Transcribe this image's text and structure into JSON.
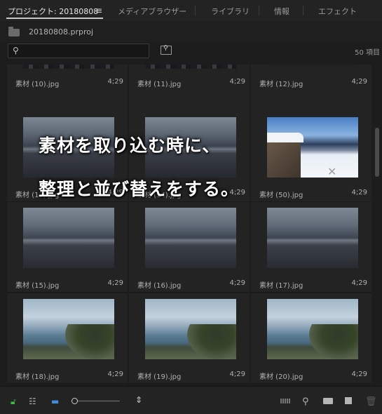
{
  "tabs": [
    {
      "label": "プロジェクト: 20180808",
      "active": true
    },
    {
      "label": "メディアブラウザー",
      "active": false
    },
    {
      "label": "ライブラリ",
      "active": false
    },
    {
      "label": "情報",
      "active": false
    },
    {
      "label": "エフェクト",
      "active": false
    }
  ],
  "tab_menu_icon": "hamburger-icon",
  "project": {
    "file_name": "20180808.prproj",
    "icon": "folder-icon"
  },
  "search": {
    "placeholder": "",
    "icon": "search-icon"
  },
  "item_count": "50 項目",
  "items": [
    {
      "name": "素材 (10).jpg",
      "duration": "4;29"
    },
    {
      "name": "素材 (11).jpg",
      "duration": "4;29"
    },
    {
      "name": "素材 (12).jpg",
      "duration": "4;29"
    },
    {
      "name": "素材 (13).jpg",
      "duration": "4;29"
    },
    {
      "name": "素材 (14).jpg",
      "duration": "4;29"
    },
    {
      "name": "素材 (50).jpg",
      "duration": "4;29"
    },
    {
      "name": "素材 (15).jpg",
      "duration": "4;29"
    },
    {
      "name": "素材 (16).jpg",
      "duration": "4;29"
    },
    {
      "name": "素材 (17).jpg",
      "duration": "4;29"
    },
    {
      "name": "素材 (18).jpg",
      "duration": "4;29"
    },
    {
      "name": "素材 (19).jpg",
      "duration": "4;29"
    },
    {
      "name": "素材 (20).jpg",
      "duration": "4;29"
    }
  ],
  "overlay_caption": {
    "line1": "素材を取り込む時に、",
    "line2": "整理と並び替えをする。"
  },
  "toolbar_icons": [
    "lock-icon",
    "list-view-icon",
    "icon-view-icon",
    "zoom-slider",
    "sort-icon",
    "automate-to-sequence-icon",
    "find-icon",
    "new-bin-icon",
    "new-item-icon",
    "trash-icon"
  ]
}
